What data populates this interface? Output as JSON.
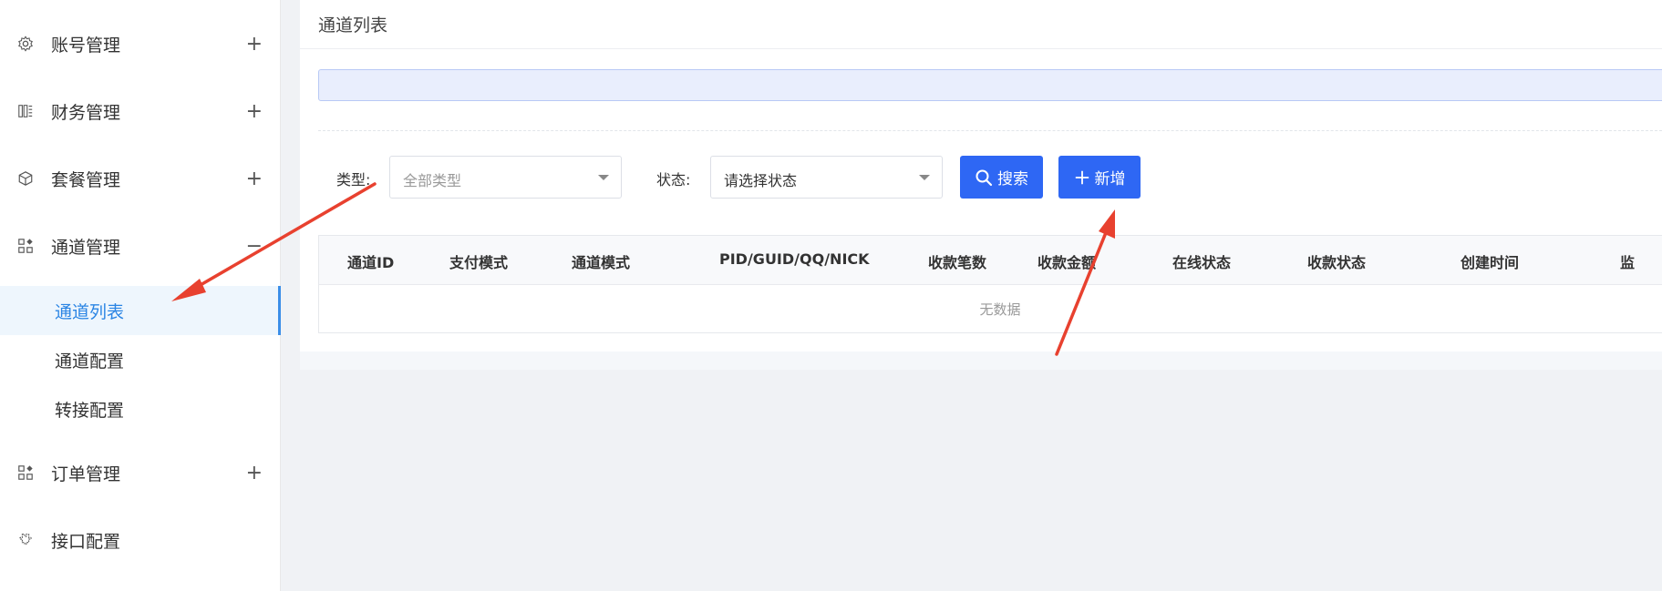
{
  "sidebar": {
    "items": [
      {
        "label": "账号管理",
        "icon": "gear-icon",
        "toggle": "+"
      },
      {
        "label": "财务管理",
        "icon": "finance-icon",
        "toggle": "+"
      },
      {
        "label": "套餐管理",
        "icon": "package-icon",
        "toggle": "+"
      },
      {
        "label": "通道管理",
        "icon": "grid-icon",
        "toggle": "−"
      },
      {
        "label": "订单管理",
        "icon": "grid-icon",
        "toggle": "+"
      },
      {
        "label": "接口配置",
        "icon": "plugin-icon",
        "toggle": ""
      }
    ],
    "sub_items": [
      {
        "label": "通道列表",
        "active": true
      },
      {
        "label": "通道配置",
        "active": false
      },
      {
        "label": "转接配置",
        "active": false
      }
    ]
  },
  "main": {
    "title": "通道列表",
    "filters": {
      "type_label": "类型:",
      "type_value": "全部类型",
      "status_label": "状态:",
      "status_value": "请选择状态"
    },
    "buttons": {
      "search": "搜索",
      "add": "新增"
    },
    "table": {
      "columns": [
        "通道ID",
        "支付模式",
        "通道模式",
        "PID/GUID/QQ/NICK",
        "收款笔数",
        "收款金额",
        "在线状态",
        "收款状态",
        "创建时间",
        "监"
      ],
      "empty_text": "无数据"
    }
  },
  "colors": {
    "accent": "#2e67f4",
    "active_menu": "#2b85e4",
    "annotation_arrow": "#e8412f"
  }
}
